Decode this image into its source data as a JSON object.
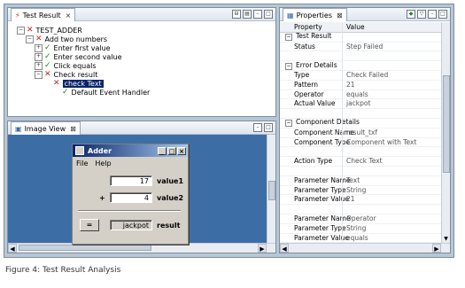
{
  "test_result": {
    "tab_label": "Test Result",
    "tree": [
      {
        "label": "TEST_ADDER",
        "status": "fail",
        "expander": "−"
      },
      {
        "label": "Add two numbers",
        "status": "fail",
        "expander": "−"
      },
      {
        "label": "Enter first value",
        "status": "pass",
        "expander": "+"
      },
      {
        "label": "Enter second value",
        "status": "pass",
        "expander": "+"
      },
      {
        "label": "Click equals",
        "status": "pass",
        "expander": "+"
      },
      {
        "label": "Check result",
        "status": "fail",
        "expander": "−"
      },
      {
        "label": "check Text",
        "status": "fail",
        "expander": ""
      },
      {
        "label": "Default Event Handler",
        "status": "pass",
        "expander": ""
      }
    ]
  },
  "image_view": {
    "tab_label": "Image View",
    "adder": {
      "title": "Adder",
      "menu": [
        "File",
        "Help"
      ],
      "value1": "17",
      "value1_label": "value1",
      "operator": "+",
      "value2": "4",
      "value2_label": "value2",
      "result_value": "jackpot",
      "result_label": "result",
      "equals_button": "="
    }
  },
  "properties": {
    "tab_label": "Properties",
    "header": {
      "property": "Property",
      "value": "Value"
    },
    "rows": [
      {
        "kind": "cat",
        "label": "Test Result"
      },
      {
        "kind": "row",
        "label": "Status",
        "value": "Step Failed"
      },
      {
        "kind": "blank"
      },
      {
        "kind": "cat",
        "label": "Error Details"
      },
      {
        "kind": "row",
        "label": "Type",
        "value": "Check Failed"
      },
      {
        "kind": "row",
        "label": "Pattern",
        "value": "21"
      },
      {
        "kind": "row",
        "label": "Operator",
        "value": "equals"
      },
      {
        "kind": "row",
        "label": "Actual Value",
        "value": "jackpot"
      },
      {
        "kind": "blank"
      },
      {
        "kind": "cat",
        "label": "Component Details"
      },
      {
        "kind": "row",
        "label": "Component Name",
        "value": "result_txf"
      },
      {
        "kind": "row",
        "label": "Component Type",
        "value": "Component with Text"
      },
      {
        "kind": "blank"
      },
      {
        "kind": "row",
        "label": "Action Type",
        "value": "Check Text"
      },
      {
        "kind": "blank"
      },
      {
        "kind": "row",
        "label": "Parameter Name",
        "value": "Text"
      },
      {
        "kind": "row",
        "label": "Parameter Type",
        "value": "String"
      },
      {
        "kind": "row",
        "label": "Parameter Value",
        "value": "21"
      },
      {
        "kind": "blank"
      },
      {
        "kind": "row",
        "label": "Parameter Name",
        "value": "Operator"
      },
      {
        "kind": "row",
        "label": "Parameter Type",
        "value": "String"
      },
      {
        "kind": "row",
        "label": "Parameter Value",
        "value": "equals"
      }
    ]
  },
  "caption": "Figure 4: Test Result Analysis"
}
